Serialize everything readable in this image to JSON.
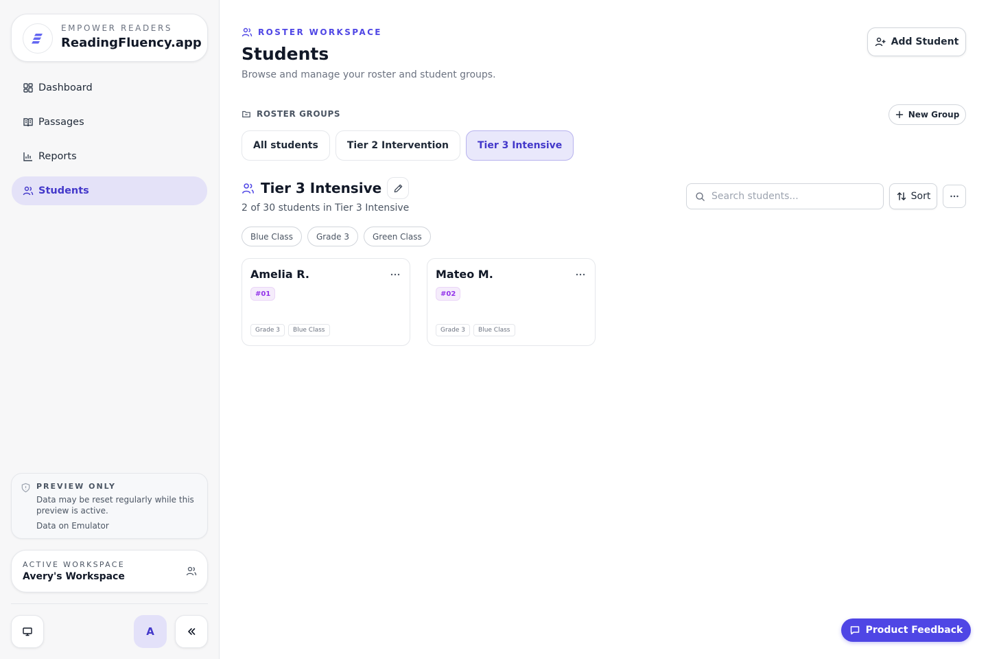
{
  "brand": {
    "eyebrow": "EMPOWER READERS",
    "name": "ReadingFluency.app"
  },
  "sidebar": {
    "items": [
      {
        "label": "Dashboard",
        "icon": "dashboard-icon",
        "active": false
      },
      {
        "label": "Passages",
        "icon": "book-open-icon",
        "active": false
      },
      {
        "label": "Reports",
        "icon": "bar-chart-icon",
        "active": false
      },
      {
        "label": "Students",
        "icon": "users-icon",
        "active": true
      }
    ],
    "preview": {
      "title": "PREVIEW ONLY",
      "text": "Data may be reset regularly while this preview is active.",
      "link": "Data on Emulator"
    },
    "workspace": {
      "label": "ACTIVE WORKSPACE",
      "name": "Avery's Workspace"
    },
    "avatar_initial": "A"
  },
  "header": {
    "eyebrow": "ROSTER WORKSPACE",
    "title": "Students",
    "subtitle": "Browse and manage your roster and student groups.",
    "add_button": "Add Student"
  },
  "groups": {
    "label": "ROSTER GROUPS",
    "new_button": "New Group",
    "tabs": [
      {
        "label": "All students",
        "active": false
      },
      {
        "label": "Tier 2 Intervention",
        "active": false
      },
      {
        "label": "Tier 3 Intensive",
        "active": true
      }
    ]
  },
  "group_detail": {
    "title": "Tier 3 Intensive",
    "count": "2 of 30 students in Tier 3 Intensive",
    "filters": [
      "Blue Class",
      "Grade 3",
      "Green Class"
    ]
  },
  "toolbar": {
    "search_placeholder": "Search students...",
    "sort_label": "Sort"
  },
  "students": [
    {
      "name": "Amelia R.",
      "id": "#01",
      "tags": [
        "Grade 3",
        "Blue Class"
      ]
    },
    {
      "name": "Mateo M.",
      "id": "#02",
      "tags": [
        "Grade 3",
        "Blue Class"
      ]
    }
  ],
  "feedback_button": "Product Feedback",
  "colors": {
    "accent": "#4f46e5",
    "accent_text": "#4338ca",
    "active_nav_bg": "#e4e2f8",
    "id_badge": "#9333ea"
  }
}
